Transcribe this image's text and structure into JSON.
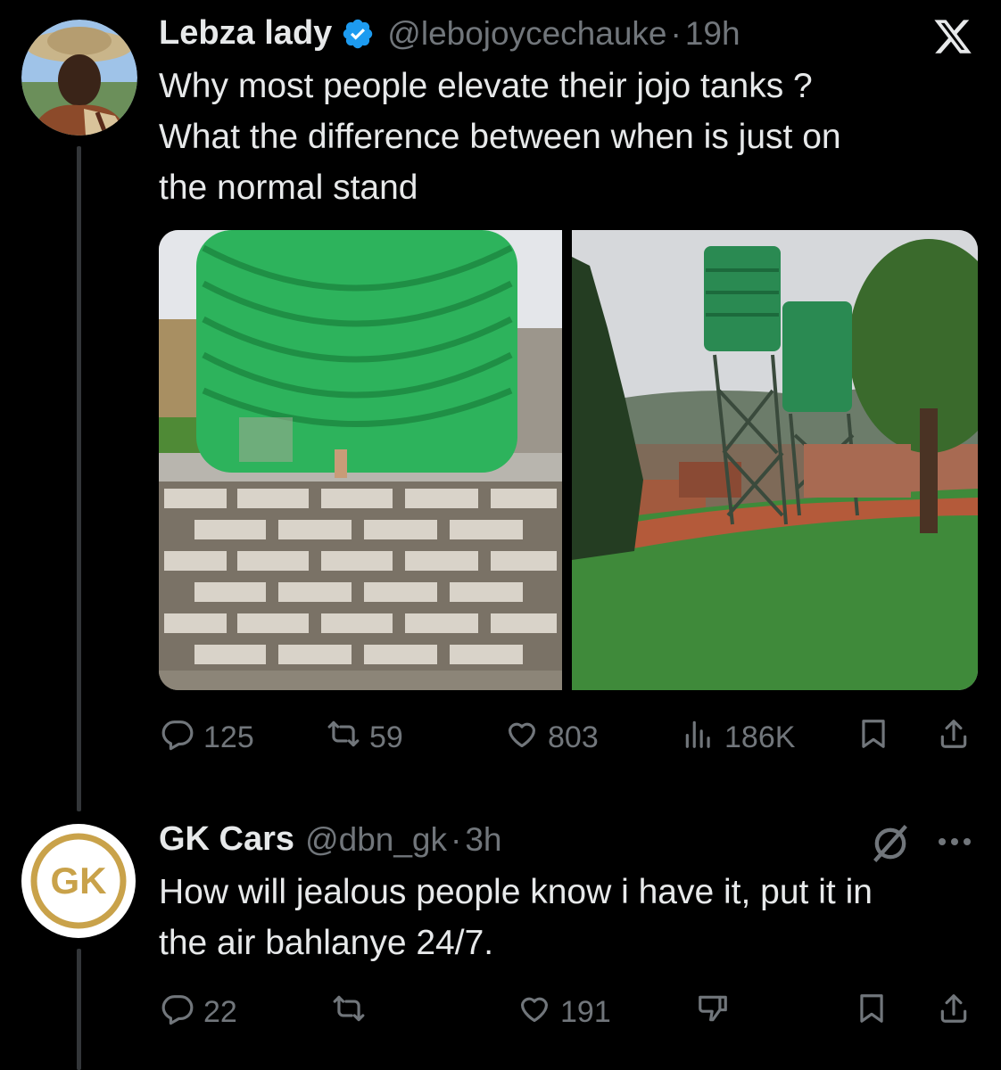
{
  "tweet": {
    "author_name": "Lebza lady",
    "handle": "@lebojoycechauke",
    "separator": "·",
    "time": "19h",
    "text_lines": [
      "Why most people elevate their jojo tanks  ?",
      "What the difference between when is just on",
      "the normal stand"
    ],
    "stats": {
      "replies": "125",
      "reposts": "59",
      "likes": "803",
      "views": "186K"
    }
  },
  "reply": {
    "author_name": "GK Cars",
    "handle": "@dbn_gk",
    "separator": "·",
    "time": "3h",
    "avatar_text": "GK",
    "text_lines": [
      "How will jealous people know i have it, put it in",
      "the air bahlanye 24/7."
    ],
    "stats": {
      "replies": "22",
      "likes": "191"
    }
  },
  "colors": {
    "background": "#000000",
    "text": "#e7e9ea",
    "muted": "#71767b",
    "verified": "#1d9bf0",
    "gold": "#c9a24a"
  }
}
